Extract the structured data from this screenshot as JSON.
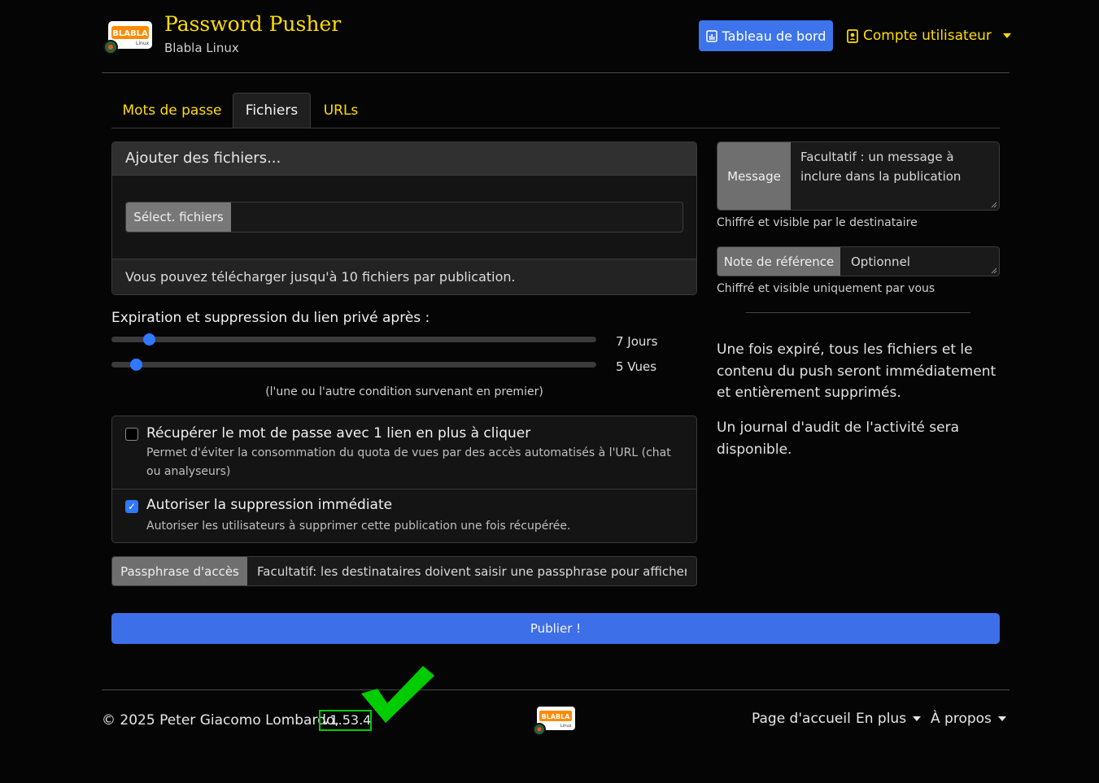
{
  "brand": {
    "title": "Password Pusher",
    "subtitle": "Blabla Linux",
    "logo_text": "BLABLA",
    "logo_subtext": "Linux"
  },
  "nav": {
    "dashboard_label": "Tableau de bord",
    "account_label": "Compte utilisateur"
  },
  "tabs": [
    {
      "label": "Mots de passe",
      "active": false
    },
    {
      "label": "Fichiers",
      "active": true
    },
    {
      "label": "URLs",
      "active": false
    }
  ],
  "files_card": {
    "header": "Ajouter des fichiers...",
    "select_button": "Sélect. fichiers",
    "footer": "Vous pouvez télécharger jusqu'à 10 fichiers par publication."
  },
  "expiration": {
    "title": "Expiration et suppression du lien privé après :",
    "days_label": "7 Jours",
    "days_value": 7,
    "views_label": "5 Vues",
    "views_value": 5,
    "note": "(l'une ou l'autre condition survenant en premier)"
  },
  "options": [
    {
      "title": "Récupérer le mot de passe avec 1 lien en plus à cliquer",
      "description": "Permet d'éviter la consommation du quota de vues par des accès automatisés à l'URL (chat ou analyseurs)",
      "checked": false
    },
    {
      "title": "Autoriser la suppression immédiate",
      "description": "Autoriser les utilisateurs à supprimer cette publication une fois récupérée.",
      "checked": true
    }
  ],
  "passphrase": {
    "label": "Passphrase d'accès",
    "placeholder": "Facultatif: les destinataires doivent saisir une passphrase pour afficher cet"
  },
  "publish_label": "Publier !",
  "message": {
    "label": "Message",
    "placeholder": "Facultatif : un message à inclure dans la publication",
    "hint": "Chiffré et visible par le destinataire"
  },
  "reference": {
    "label": "Note de référence",
    "placeholder": "Optionnel",
    "hint": "Chiffré et visible uniquement par vous"
  },
  "info": {
    "expiry_text": "Une fois expiré, tous les fichiers et le contenu du push seront immédiatement et entièrement supprimés.",
    "audit_text": "Un journal d'audit de l'activité sera disponible."
  },
  "footer": {
    "copyright": "© 2025 Peter Giacomo Lombardo,",
    "version": "v1.53.4",
    "links": [
      "Page d'accueil",
      "En plus",
      "À propos"
    ]
  },
  "colors": {
    "accent_yellow": "#ffdd00",
    "primary_blue": "#3d74eb",
    "highlight_green": "#00cc00"
  }
}
